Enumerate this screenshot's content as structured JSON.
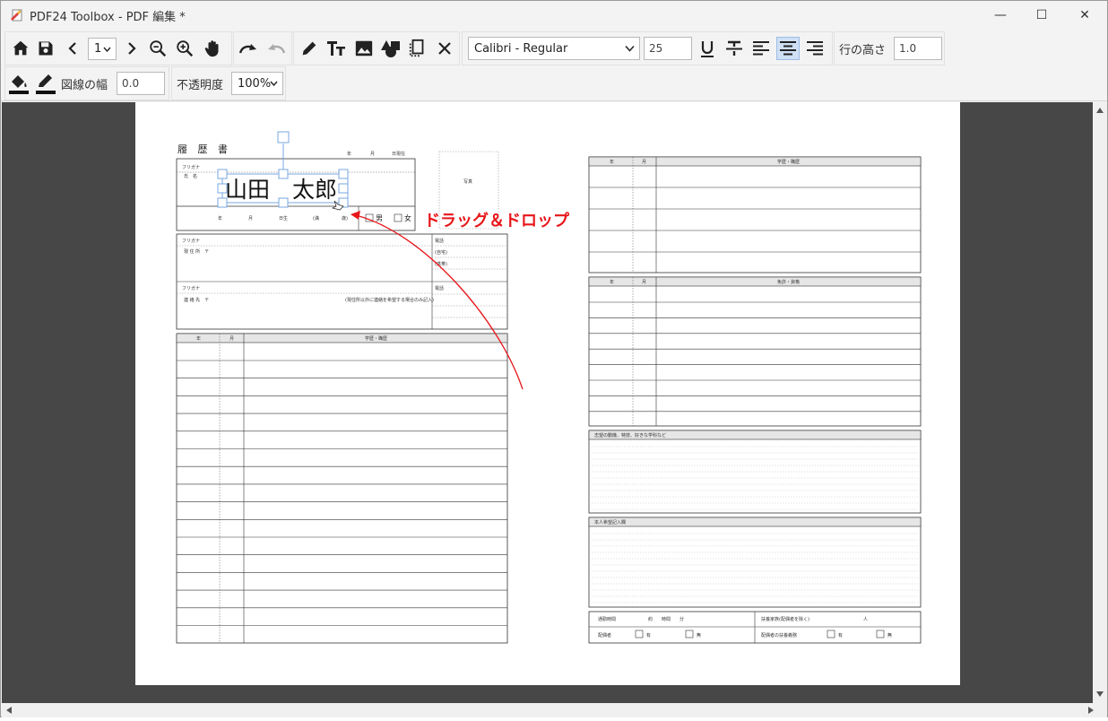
{
  "window": {
    "title": "PDF24 Toolbox - PDF 編集 *",
    "controls": {
      "minimize": "—",
      "maximize": "☐",
      "close": "✕"
    }
  },
  "toolbar": {
    "page_select": "1",
    "font_select": "Calibri - Regular",
    "font_size": "25",
    "line_height_label": "行の高さ",
    "line_height_value": "1.0",
    "line_width_label": "図線の幅",
    "line_width_value": "0.0",
    "opacity_label": "不透明度",
    "opacity_value": "100%",
    "active_align": "center",
    "icons": [
      "home-icon",
      "save-icon",
      "prev-page-icon",
      "next-page-icon",
      "zoom-out-icon",
      "zoom-in-icon",
      "hand-icon",
      "redo-icon",
      "undo-icon",
      "pen-icon",
      "text-icon",
      "image-icon",
      "shapes-icon",
      "select-icon",
      "delete-icon",
      "underline-icon",
      "strikethrough-icon",
      "align-left-icon",
      "align-center-icon",
      "align-right-icon",
      "fill-color-icon",
      "stroke-color-icon"
    ]
  },
  "resume": {
    "heading": "履 歴 書",
    "date_line": {
      "year": "年",
      "month": "月",
      "day": "日現在"
    },
    "furigana": "フリガナ",
    "name_label": "氏　名",
    "name_value": "山田　太郎",
    "birth": {
      "year": "年",
      "month": "月",
      "day": "日生",
      "age_open": "(満",
      "age_close": "歳)"
    },
    "gender": {
      "male": "男",
      "female": "女"
    },
    "photo_label": "写真",
    "address_label": "現 住 所　〒",
    "contact_label": "連 絡 先　〒",
    "contact_note": "(現住所以外に連絡を希望する場合のみ記入)",
    "phone_label": "電話",
    "home_label": "(自宅)",
    "mobile_label": "(携帯)",
    "history_header": {
      "year": "年",
      "month": "月",
      "content": "学歴・職歴"
    },
    "history_right_header": {
      "year": "年",
      "month": "月",
      "content": "学歴・職歴"
    },
    "license_header": {
      "year": "年",
      "month": "月",
      "content": "免許・資格"
    },
    "motivation_label": "志望の動機、特技、好きな学科など",
    "wish_label": "本人希望記入欄",
    "commute_label": "通勤時間",
    "commute_hours": "約　　時間　　分",
    "dependents_label": "扶養家族(配偶者を除く)",
    "dependents_unit": "人",
    "spouse_label": "配偶者",
    "spouse_obligation_label": "配偶者の扶養義務",
    "yes": "有",
    "no": "無"
  },
  "annotation": {
    "text": "ドラッグ＆ドロップ",
    "color": "#e8161a"
  },
  "colors": {
    "accent": "#e8161a",
    "selection": "#7aa7e0",
    "active_button": "#cfe0f5",
    "canvas_bg": "#474747"
  }
}
